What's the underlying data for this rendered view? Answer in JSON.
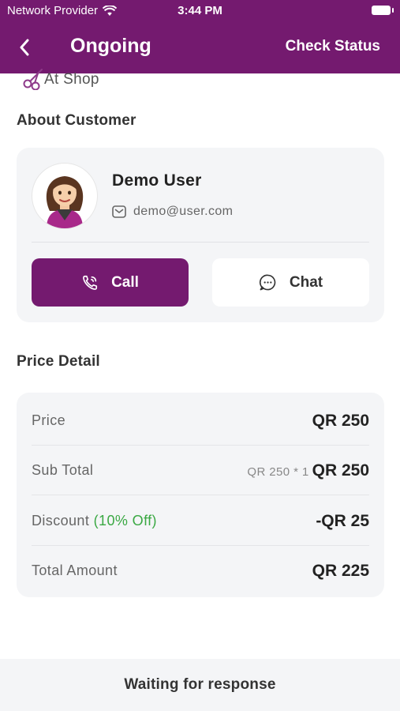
{
  "status_bar": {
    "carrier": "Network Provider",
    "time": "3:44 PM"
  },
  "header": {
    "title": "Ongoing",
    "action": "Check Status"
  },
  "service": {
    "type": "At Shop",
    "icon": "scissors-icon"
  },
  "customer": {
    "section_title": "About Customer",
    "name": "Demo User",
    "email": "demo@user.com",
    "call_label": "Call",
    "chat_label": "Chat"
  },
  "price": {
    "section_title": "Price Detail",
    "price_label": "Price",
    "price_value": "QR 250",
    "subtotal_label": "Sub Total",
    "subtotal_qty": "QR 250 * 1",
    "subtotal_value": "QR 250",
    "discount_label": "Discount",
    "discount_percent": "(10% Off)",
    "discount_value": "-QR 25",
    "total_label": "Total Amount",
    "total_value": "QR 225"
  },
  "footer": {
    "status": "Waiting for response"
  },
  "colors": {
    "brand": "#741a6f",
    "discount": "#3aa843",
    "card_bg": "#f4f5f7"
  }
}
